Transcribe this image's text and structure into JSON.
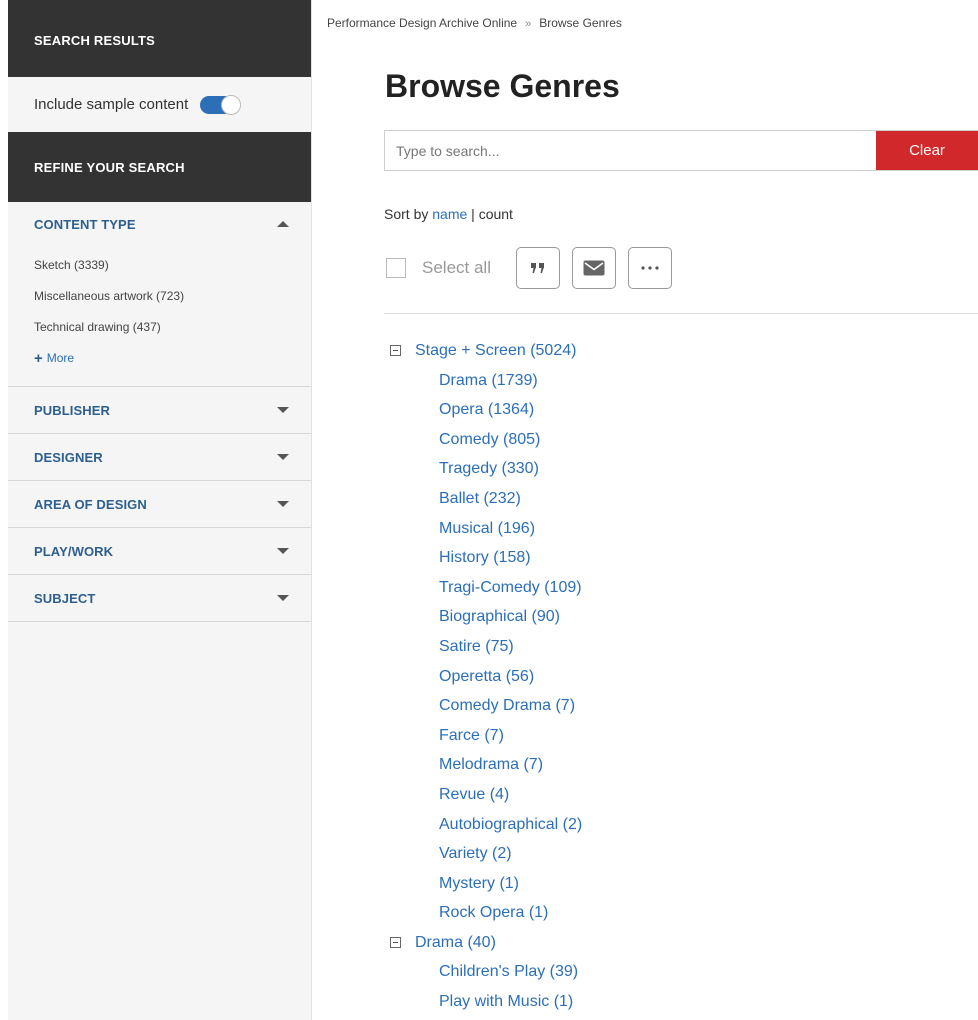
{
  "sidebar": {
    "search_results_title": "SEARCH RESULTS",
    "include_sample_label": "Include sample content",
    "include_sample_on": true,
    "refine_title": "REFINE YOUR SEARCH",
    "content_type": {
      "title": "CONTENT TYPE",
      "expanded": true,
      "items": [
        "Sketch (3339)",
        "Miscellaneous artwork (723)",
        "Technical drawing (437)"
      ],
      "more_label": "More"
    },
    "facets": [
      "PUBLISHER",
      "DESIGNER",
      "AREA OF DESIGN",
      "PLAY/WORK",
      "SUBJECT"
    ]
  },
  "breadcrumb": {
    "root": "Performance Design Archive Online",
    "separator": "»",
    "current": "Browse Genres"
  },
  "page_title": "Browse Genres",
  "search": {
    "placeholder": "Type to search...",
    "value": "",
    "clear_label": "Clear"
  },
  "sort": {
    "prefix": "Sort by",
    "name_label": "name",
    "separator": "|",
    "count_label": "count"
  },
  "toolbar": {
    "select_all_label": "Select all",
    "icons": [
      "quote-icon",
      "envelope-icon",
      "more-dots-icon"
    ]
  },
  "genres": [
    {
      "label": "Stage + Screen (5024)",
      "children": [
        "Drama (1739)",
        "Opera (1364)",
        "Comedy (805)",
        "Tragedy (330)",
        "Ballet (232)",
        "Musical (196)",
        "History (158)",
        "Tragi-Comedy (109)",
        "Biographical (90)",
        "Satire (75)",
        "Operetta (56)",
        "Comedy Drama (7)",
        "Farce (7)",
        "Melodrama (7)",
        "Revue (4)",
        "Autobiographical (2)",
        "Variety (2)",
        "Mystery (1)",
        "Rock Opera (1)"
      ]
    },
    {
      "label": "Drama (40)",
      "children": [
        "Children's Play (39)",
        "Play with Music (1)"
      ]
    }
  ],
  "colors": {
    "dark_header": "#333333",
    "link_blue": "#2c6fb7",
    "facet_title": "#2c5f8f",
    "clear_red": "#d0282b",
    "sidebar_bg": "#f5f5f5"
  }
}
